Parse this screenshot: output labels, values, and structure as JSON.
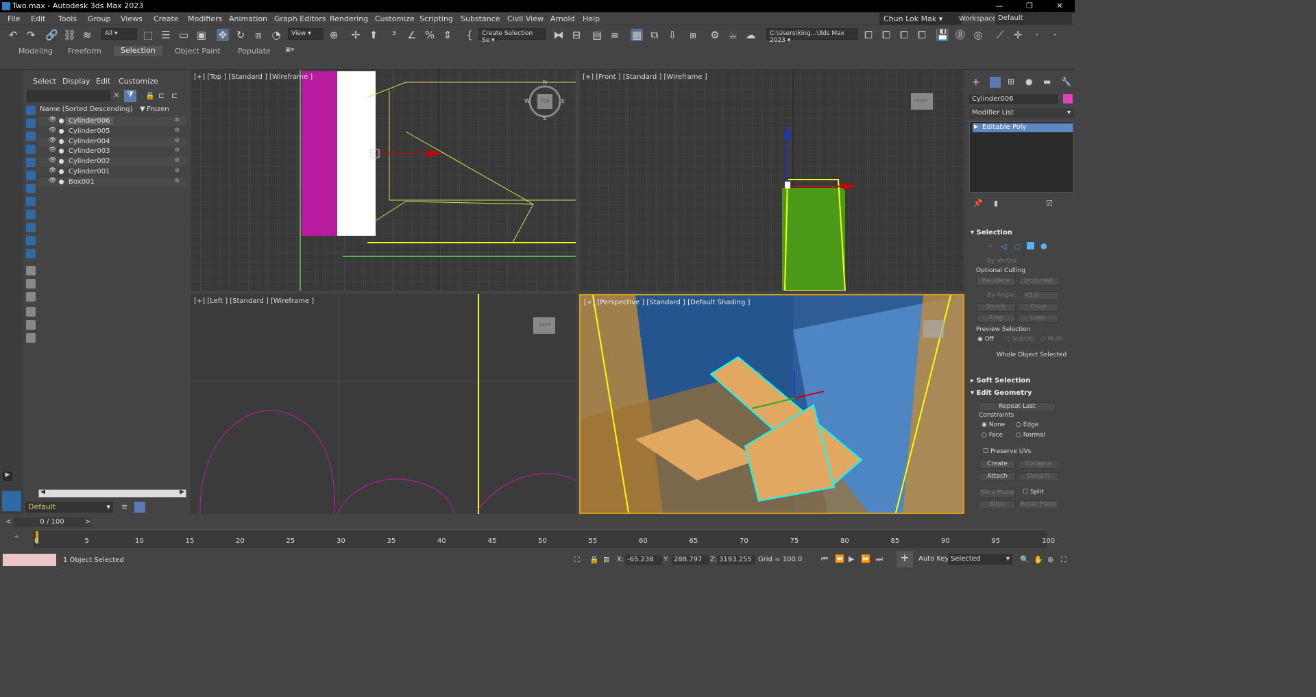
{
  "window": {
    "title": "Two.max - Autodesk 3ds Max 2023",
    "min": "—",
    "max": "❐",
    "close": "✕"
  },
  "menu": [
    "File",
    "Edit",
    "Tools",
    "Group",
    "Views",
    "Create",
    "Modifiers",
    "Animation",
    "Graph Editors",
    "Rendering",
    "Customize",
    "Scripting",
    "Substance",
    "Civil View",
    "Arnold",
    "Help"
  ],
  "user": {
    "name": "Chun Lok Mak"
  },
  "workspace": {
    "label": "Workspaces:",
    "value": "Default"
  },
  "toolbar": {
    "filter_value": "All",
    "view_value": "View",
    "selection_set": "Create Selection Se",
    "path": "C:\\Users\\king...\\3ds Max 2023"
  },
  "ribbon": {
    "tabs": [
      "Modeling",
      "Freeform",
      "Selection",
      "Object Paint",
      "Populate"
    ],
    "active": "Selection"
  },
  "explorer": {
    "menu": [
      "Select",
      "Display",
      "Edit",
      "Customize"
    ],
    "column_name": "Name (Sorted Descending)",
    "column_frozen": "Frozen",
    "rows": [
      "Cylinder006",
      "Cylinder005",
      "Cylinder004",
      "Cylinder003",
      "Cylinder002",
      "Cylinder001",
      "Box001"
    ],
    "selected_row": "Cylinder006",
    "layer": "Default"
  },
  "viewports": {
    "top": "[+] [Top ] [Standard ] [Wireframe ]",
    "front": "[+] [Front ] [Standard ] [Wireframe ]",
    "left": "[+] [Left ] [Standard ] [Wireframe ]",
    "perspective": "[+] [Perspective ] [Standard ] [Default Shading ]",
    "cube_top": "TOP",
    "cube_front": "FRONT",
    "cube_left": "LEFT",
    "compass": {
      "n": "N",
      "s": "S",
      "e": "E",
      "w": "W"
    }
  },
  "command_panel": {
    "object_name": "Cylinder006",
    "modifier_list": "Modifier List",
    "stack_item": "Editable Poly",
    "selection": {
      "title": "Selection",
      "by_vertex": "By Vertex",
      "optional_culling": "Optional Culling",
      "backface": "Backface",
      "occluded": "Occluded",
      "by_angle": "By Angle:",
      "angle_value": "45.0",
      "shrink": "Shrink",
      "grow": "Grow",
      "ring": "Ring",
      "loop": "Loop",
      "preview_selection": "Preview Selection",
      "off": "Off",
      "subobj": "SubObj",
      "multi": "Multi",
      "whole_object": "Whole Object Selected"
    },
    "soft_selection": "Soft Selection",
    "edit_geometry": {
      "title": "Edit Geometry",
      "repeat_last": "Repeat Last",
      "constraints": "Constraints",
      "none": "None",
      "edge": "Edge",
      "face": "Face",
      "normal": "Normal",
      "preserve_uvs": "Preserve UVs",
      "create": "Create",
      "collapse": "Collapse",
      "attach": "Attach",
      "detach": "Detach",
      "slice_plane": "Slice Plane",
      "split": "Split",
      "slice": "Slice",
      "reset_plane": "Reset Plane"
    }
  },
  "timeline": {
    "frame_display": "0 / 100",
    "ticks": [
      "0",
      "5",
      "10",
      "15",
      "20",
      "25",
      "30",
      "35",
      "40",
      "45",
      "50",
      "55",
      "60",
      "65",
      "70",
      "75",
      "80",
      "85",
      "90",
      "95",
      "100"
    ],
    "status": "1 Object Selected",
    "x_label": "X:",
    "x_value": "-65.238",
    "y_label": "Y:",
    "y_value": "288.797",
    "z_label": "Z:",
    "z_value": "3193.255",
    "grid": "Grid = 100.0",
    "auto_key": "Auto Key",
    "selected_dropdown": "Selected"
  }
}
